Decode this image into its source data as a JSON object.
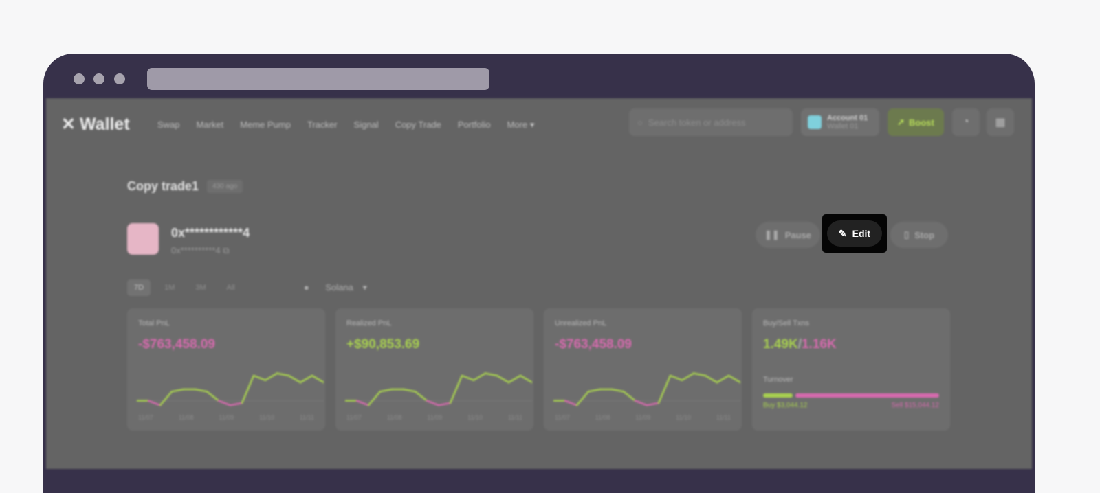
{
  "nav": {
    "logo": "Wallet",
    "links": [
      "Swap",
      "Market",
      "Meme Pump",
      "Tracker",
      "Signal",
      "Copy Trade",
      "Portfolio",
      "More"
    ],
    "search_placeholder": "Search token or address",
    "account_name": "Account 01",
    "account_sub": "Wallet 01",
    "boost": "Boost"
  },
  "page": {
    "title": "Copy trade1",
    "tag": "430 ago",
    "address": "0x************4",
    "address_short": "0x**********4",
    "actions": {
      "pause": "Pause",
      "edit": "Edit",
      "stop": "Stop"
    },
    "time_tabs": [
      "7D",
      "1M",
      "3M",
      "All"
    ],
    "chain": "Solana"
  },
  "cards": [
    {
      "label": "Total PnL",
      "value": "-$763,458.09",
      "tone": "neg"
    },
    {
      "label": "Realized PnL",
      "value": "+$90,853.69",
      "tone": "pos"
    },
    {
      "label": "Unrealized PnL",
      "value": "-$763,458.09",
      "tone": "neg"
    }
  ],
  "chart_data": {
    "type": "line",
    "x": [
      "11/07",
      "11/08",
      "11/09",
      "11/10",
      "11/11"
    ],
    "values": [
      0,
      0,
      -1,
      2,
      2.5,
      2.5,
      2,
      0,
      -1,
      -0.5,
      5.5,
      4.5,
      6,
      5.5,
      4,
      5.5,
      4
    ],
    "colors": {
      "positive": "#a9d24f",
      "negative": "#d86aaf"
    }
  },
  "trades": {
    "label": "Buy/Sell Txns",
    "buy": "1.49K",
    "sep": "/",
    "sell": "1.16K",
    "turnover_label": "Turnover",
    "buy_amount": "Buy $3,044.12",
    "sell_amount": "Sell $15,044.12",
    "buy_fraction": 0.17
  },
  "colors": {
    "frame": "#37314a",
    "overlay": "#646464",
    "buy": "#a9d24f",
    "sell": "#d86aaf"
  }
}
